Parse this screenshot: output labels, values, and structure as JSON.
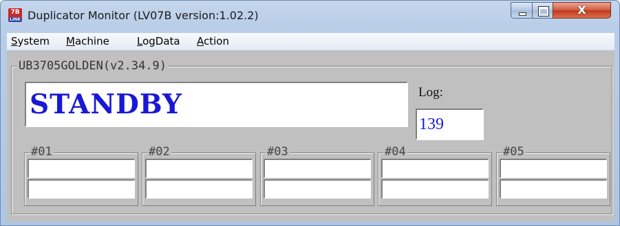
{
  "window": {
    "icon_top": "7B",
    "icon_bottom": "LINK",
    "title": "Duplicator Monitor (LV07B version:1.02.2)",
    "close_glyph": "X"
  },
  "menu": [
    {
      "label": "System",
      "mnemonic": "S"
    },
    {
      "label": "Machine",
      "mnemonic": "M"
    },
    {
      "label": "LogData",
      "mnemonic": "L"
    },
    {
      "label": "Action",
      "mnemonic": "A"
    }
  ],
  "device": {
    "group_label": "UB3705GOLDEN(v2.34.9)",
    "status": "STANDBY",
    "log_label": "Log:",
    "log_value": "139"
  },
  "slots": [
    {
      "label": "#01",
      "line1": "",
      "line2": ""
    },
    {
      "label": "#02",
      "line1": "",
      "line2": ""
    },
    {
      "label": "#03",
      "line1": "",
      "line2": ""
    },
    {
      "label": "#04",
      "line1": "",
      "line2": ""
    },
    {
      "label": "#05",
      "line1": "",
      "line2": ""
    }
  ],
  "colors": {
    "status_text": "#1a17d6",
    "panel_bg": "#c0c0c0"
  }
}
